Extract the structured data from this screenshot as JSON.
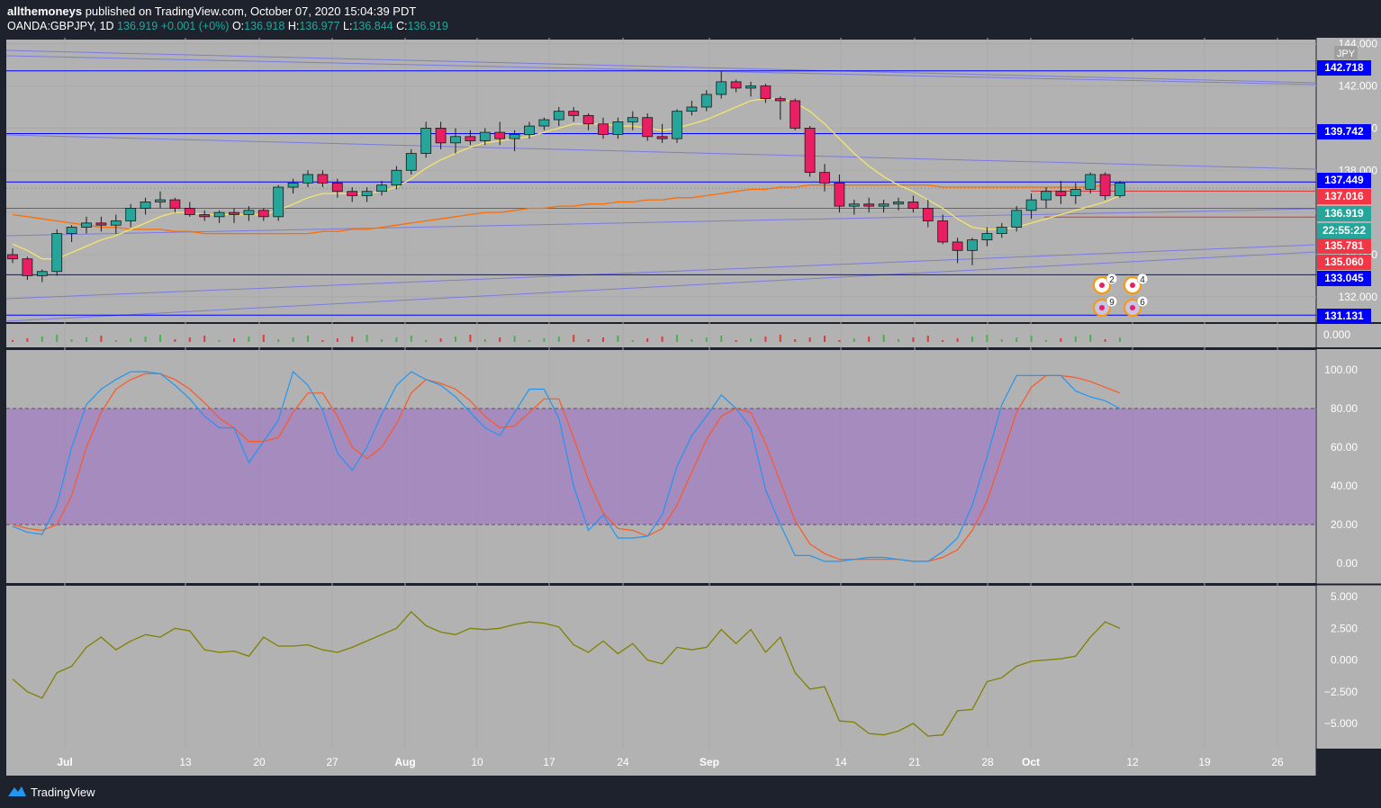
{
  "header": {
    "author": "allthemoneys",
    "published": " published on TradingView.com, October 07, 2020 15:04:39 PDT",
    "symbol": "OANDA:GBPJPY, 1D",
    "last": "136.919",
    "change": "+0.001 (+0%)",
    "o_label": "O:",
    "o_val": "136.918",
    "h_label": "H:",
    "h_val": "136.977",
    "l_label": "L:",
    "l_val": "136.844",
    "c_label": "C:",
    "c_val": "136.919"
  },
  "currency_badge": "JPY",
  "footer": {
    "brand": "TradingView"
  },
  "colors": {
    "bg": "#b2b2b2",
    "up": "#26a69a",
    "down": "#e91e63",
    "level": "#0000ff",
    "ma_fast": "#f5e46b",
    "ma_mid": "#4caf50",
    "ma_slow": "#ff6d00",
    "stoch_k": "#2196f3",
    "stoch_d": "#ff5722",
    "osc": "#808000",
    "band": "#9c6bc9"
  },
  "x_labels": [
    "Jul",
    "13",
    "20",
    "27",
    "Aug",
    "10",
    "17",
    "24",
    "Sep",
    "14",
    "21",
    "28",
    "Oct",
    "12",
    "19",
    "26"
  ],
  "price_ticks": [
    "144.000",
    "142.000",
    "140.000",
    "138.000",
    "134.000",
    "132.000"
  ],
  "price_tags": [
    {
      "text": "142.718",
      "value": 142.718,
      "color": "#0000ff"
    },
    {
      "text": "139.742",
      "value": 139.742,
      "color": "#0000ff"
    },
    {
      "text": "137.449",
      "value": 137.449,
      "color": "#0000ff"
    },
    {
      "text": "137.016",
      "value": 137.016,
      "color": "#f23645"
    },
    {
      "text": "136.919",
      "value": 136.919,
      "color": "#26a69a"
    },
    {
      "text": "22:55:22",
      "value": 136.55,
      "color": "#26a69a"
    },
    {
      "text": "135.781",
      "value": 135.781,
      "color": "#f23645"
    },
    {
      "text": "135.060",
      "value": 135.06,
      "color": "#f23645"
    },
    {
      "text": "133.045",
      "value": 133.045,
      "color": "#0000ff"
    },
    {
      "text": "131.131",
      "value": 131.131,
      "color": "#0000ff"
    }
  ],
  "volume_label": "0.000",
  "stoch_ticks": [
    "100.00",
    "80.00",
    "60.00",
    "40.00",
    "20.00",
    "0.00"
  ],
  "osc_ticks": [
    "5.000",
    "2.500",
    "0.000",
    "−2.500",
    "−5.000"
  ],
  "events": [
    {
      "label": "2",
      "kind": "dot"
    },
    {
      "label": "4",
      "kind": "dot"
    },
    {
      "label": "9",
      "kind": "flag"
    },
    {
      "label": "6",
      "kind": "flag"
    }
  ],
  "chart_data": {
    "type": "candlestick",
    "ylim": [
      130.8,
      144.2
    ],
    "candles": [
      [
        134.0,
        134.3,
        133.6,
        133.8
      ],
      [
        133.8,
        133.9,
        132.8,
        133.0
      ],
      [
        133.0,
        133.3,
        132.7,
        133.2
      ],
      [
        133.2,
        135.2,
        133.0,
        135.0
      ],
      [
        135.0,
        135.4,
        134.6,
        135.3
      ],
      [
        135.3,
        135.8,
        135.0,
        135.5
      ],
      [
        135.5,
        135.8,
        135.1,
        135.4
      ],
      [
        135.4,
        135.9,
        135.0,
        135.6
      ],
      [
        135.6,
        136.4,
        135.3,
        136.2
      ],
      [
        136.2,
        136.7,
        135.9,
        136.5
      ],
      [
        136.5,
        137.0,
        136.2,
        136.6
      ],
      [
        136.6,
        136.7,
        136.0,
        136.2
      ],
      [
        136.2,
        136.5,
        135.8,
        135.9
      ],
      [
        135.9,
        136.1,
        135.6,
        135.8
      ],
      [
        135.8,
        136.1,
        135.5,
        136.0
      ],
      [
        136.0,
        136.2,
        135.5,
        135.9
      ],
      [
        135.9,
        136.3,
        135.6,
        136.1
      ],
      [
        136.1,
        136.2,
        135.6,
        135.8
      ],
      [
        135.8,
        137.3,
        135.6,
        137.2
      ],
      [
        137.2,
        137.6,
        136.9,
        137.4
      ],
      [
        137.4,
        138.0,
        137.2,
        137.8
      ],
      [
        137.8,
        138.0,
        137.2,
        137.4
      ],
      [
        137.4,
        137.6,
        136.7,
        137.0
      ],
      [
        137.0,
        137.2,
        136.5,
        136.8
      ],
      [
        136.8,
        137.2,
        136.5,
        137.0
      ],
      [
        137.0,
        137.5,
        136.8,
        137.3
      ],
      [
        137.3,
        138.2,
        137.1,
        138.0
      ],
      [
        138.0,
        139.0,
        137.8,
        138.8
      ],
      [
        138.8,
        140.3,
        138.6,
        140.0
      ],
      [
        140.0,
        140.3,
        139.0,
        139.3
      ],
      [
        139.3,
        140.0,
        138.8,
        139.6
      ],
      [
        139.6,
        139.9,
        139.2,
        139.4
      ],
      [
        139.4,
        140.0,
        139.2,
        139.8
      ],
      [
        139.8,
        140.3,
        139.2,
        139.5
      ],
      [
        139.5,
        139.9,
        138.9,
        139.7
      ],
      [
        139.7,
        140.3,
        139.5,
        140.1
      ],
      [
        140.1,
        140.5,
        139.9,
        140.4
      ],
      [
        140.4,
        141.0,
        140.1,
        140.8
      ],
      [
        140.8,
        141.0,
        140.3,
        140.6
      ],
      [
        140.6,
        140.7,
        139.9,
        140.2
      ],
      [
        140.2,
        140.5,
        139.5,
        139.7
      ],
      [
        139.7,
        140.5,
        139.5,
        140.3
      ],
      [
        140.3,
        140.8,
        139.9,
        140.5
      ],
      [
        140.5,
        140.7,
        139.4,
        139.6
      ],
      [
        139.6,
        140.2,
        139.3,
        139.5
      ],
      [
        139.5,
        140.9,
        139.3,
        140.8
      ],
      [
        140.8,
        141.3,
        140.6,
        141.0
      ],
      [
        141.0,
        141.8,
        140.8,
        141.6
      ],
      [
        141.6,
        142.7,
        141.4,
        142.2
      ],
      [
        142.2,
        142.3,
        141.7,
        141.9
      ],
      [
        141.9,
        142.2,
        141.5,
        142.0
      ],
      [
        142.0,
        142.1,
        141.2,
        141.4
      ],
      [
        141.4,
        141.5,
        140.4,
        141.3
      ],
      [
        141.3,
        141.4,
        139.9,
        140.0
      ],
      [
        140.0,
        140.1,
        137.7,
        137.9
      ],
      [
        137.9,
        138.3,
        137.0,
        137.4
      ],
      [
        137.4,
        137.8,
        136.0,
        136.3
      ],
      [
        136.3,
        136.6,
        135.9,
        136.4
      ],
      [
        136.4,
        136.7,
        136.0,
        136.3
      ],
      [
        136.3,
        136.6,
        136.0,
        136.4
      ],
      [
        136.4,
        136.7,
        136.1,
        136.5
      ],
      [
        136.5,
        136.8,
        136.0,
        136.2
      ],
      [
        136.2,
        136.6,
        135.3,
        135.6
      ],
      [
        135.6,
        135.9,
        134.5,
        134.6
      ],
      [
        134.6,
        134.8,
        133.6,
        134.2
      ],
      [
        134.2,
        134.8,
        133.5,
        134.7
      ],
      [
        134.7,
        135.3,
        134.4,
        135.0
      ],
      [
        135.0,
        135.5,
        134.8,
        135.3
      ],
      [
        135.3,
        136.3,
        135.1,
        136.1
      ],
      [
        136.1,
        136.9,
        135.7,
        136.6
      ],
      [
        136.6,
        137.2,
        136.2,
        137.0
      ],
      [
        137.0,
        137.5,
        136.4,
        136.8
      ],
      [
        136.8,
        137.4,
        136.4,
        137.1
      ],
      [
        137.1,
        137.9,
        136.9,
        137.8
      ],
      [
        137.8,
        137.9,
        136.6,
        136.8
      ],
      [
        136.8,
        137.5,
        136.7,
        137.4
      ]
    ],
    "ma_fast": [
      134.5,
      134.2,
      133.8,
      133.8,
      134.1,
      134.4,
      134.7,
      134.9,
      135.2,
      135.5,
      135.8,
      136.0,
      136.0,
      135.9,
      135.9,
      135.9,
      135.9,
      135.9,
      136.1,
      136.4,
      136.7,
      136.9,
      136.9,
      136.9,
      136.9,
      137.0,
      137.2,
      137.6,
      138.1,
      138.5,
      138.8,
      139.1,
      139.3,
      139.4,
      139.5,
      139.6,
      139.8,
      140.0,
      140.2,
      140.2,
      140.2,
      140.1,
      140.1,
      140.0,
      139.9,
      140.0,
      140.2,
      140.4,
      140.7,
      141.0,
      141.3,
      141.4,
      141.4,
      141.2,
      140.8,
      140.2,
      139.5,
      138.8,
      138.2,
      137.7,
      137.3,
      137.0,
      136.6,
      136.2,
      135.7,
      135.3,
      135.2,
      135.2,
      135.3,
      135.5,
      135.7,
      135.9,
      136.1,
      136.3,
      136.5,
      136.8
    ],
    "ma_slow": [
      135.9,
      135.8,
      135.7,
      135.6,
      135.5,
      135.4,
      135.3,
      135.3,
      135.2,
      135.2,
      135.2,
      135.1,
      135.1,
      135.0,
      135.0,
      135.0,
      135.0,
      135.0,
      135.0,
      135.0,
      135.0,
      135.1,
      135.1,
      135.2,
      135.2,
      135.3,
      135.4,
      135.5,
      135.6,
      135.7,
      135.8,
      135.9,
      136.0,
      136.0,
      136.1,
      136.2,
      136.2,
      136.3,
      136.3,
      136.4,
      136.4,
      136.5,
      136.5,
      136.6,
      136.6,
      136.7,
      136.7,
      136.8,
      136.9,
      137.0,
      137.1,
      137.1,
      137.2,
      137.2,
      137.3,
      137.3,
      137.3,
      137.3,
      137.3,
      137.3,
      137.3,
      137.3,
      137.3,
      137.2,
      137.2,
      137.2,
      137.2,
      137.2,
      137.2,
      137.2,
      137.2,
      137.2,
      137.2,
      137.2,
      137.3,
      137.3
    ],
    "stoch_k": [
      19,
      16,
      15,
      30,
      60,
      82,
      90,
      95,
      99,
      99,
      98,
      92,
      85,
      76,
      70,
      70,
      52,
      63,
      74,
      99,
      92,
      79,
      57,
      48,
      60,
      77,
      92,
      99,
      95,
      92,
      86,
      78,
      70,
      66,
      78,
      90,
      90,
      75,
      40,
      17,
      25,
      13,
      13,
      14,
      25,
      50,
      66,
      76,
      87,
      80,
      70,
      38,
      20,
      4,
      4,
      1,
      1,
      2,
      3,
      3,
      2,
      1,
      1,
      6,
      13,
      30,
      55,
      82,
      97,
      97,
      97,
      97,
      89,
      86,
      84,
      80
    ],
    "stoch_d": [
      20,
      18,
      17,
      20,
      35,
      60,
      78,
      90,
      95,
      98,
      98,
      95,
      90,
      83,
      75,
      70,
      63,
      63,
      65,
      78,
      88,
      88,
      76,
      60,
      54,
      60,
      72,
      88,
      95,
      93,
      90,
      84,
      76,
      70,
      71,
      78,
      85,
      85,
      65,
      43,
      26,
      18,
      17,
      14,
      18,
      30,
      47,
      64,
      76,
      80,
      78,
      62,
      42,
      22,
      10,
      5,
      2,
      2,
      2,
      2,
      2,
      1,
      1,
      3,
      7,
      17,
      32,
      55,
      78,
      91,
      97,
      97,
      96,
      94,
      91,
      88
    ],
    "osc": [
      -1.5,
      -2.5,
      -3.0,
      -1.0,
      -0.5,
      1.0,
      1.8,
      0.8,
      1.5,
      2.0,
      1.8,
      2.5,
      2.3,
      0.8,
      0.6,
      0.7,
      0.3,
      1.8,
      1.1,
      1.1,
      1.2,
      0.8,
      0.6,
      1.0,
      1.5,
      2.0,
      2.5,
      3.8,
      2.7,
      2.2,
      2.0,
      2.5,
      2.4,
      2.5,
      2.8,
      3.0,
      2.9,
      2.6,
      1.2,
      0.6,
      1.5,
      0.5,
      1.3,
      0.0,
      -0.3,
      1.0,
      0.8,
      1.0,
      2.4,
      1.3,
      2.4,
      0.6,
      1.8,
      -1.0,
      -2.3,
      -2.1,
      -4.8,
      -4.9,
      -5.8,
      -5.9,
      -5.6,
      -5.0,
      -6.0,
      -5.9,
      -4.0,
      -3.9,
      -1.7,
      -1.4,
      -0.5,
      -0.1,
      0.0,
      0.1,
      0.3,
      1.8,
      3.0,
      2.5
    ]
  }
}
